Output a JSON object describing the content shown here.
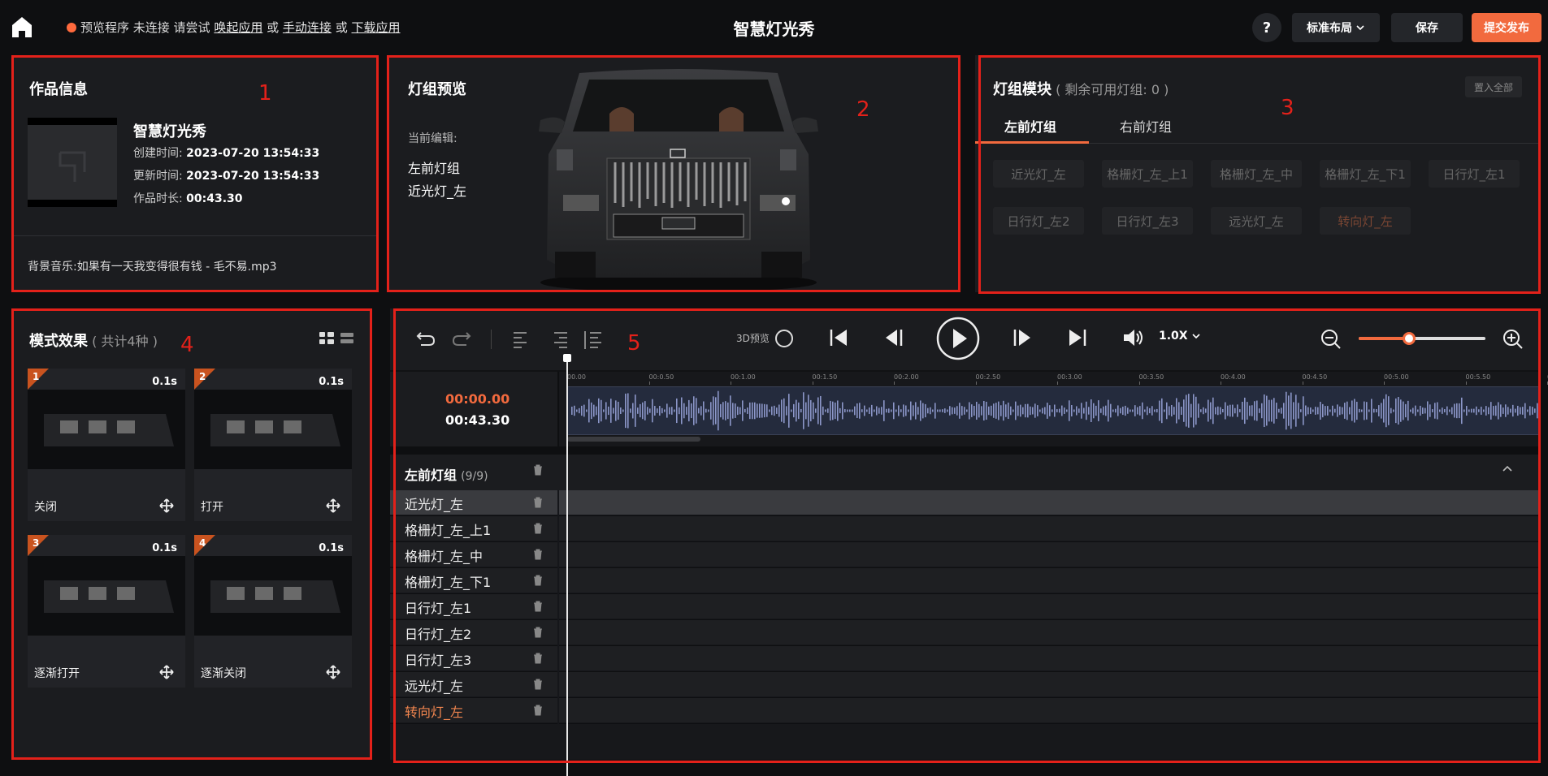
{
  "topbar": {
    "status_text": "预览程序 未连接 请尝试",
    "link_wake": "唤起应用",
    "or1": "或",
    "link_manual": "手动连接",
    "or2": "或",
    "link_download": "下载应用",
    "title": "智慧灯光秀",
    "help": "?",
    "layout_label": "标准布局",
    "save_label": "保存",
    "publish_label": "提交发布"
  },
  "works_info": {
    "panel_title": "作品信息",
    "annotation": "1",
    "name": "智慧灯光秀",
    "created_label": "创建时间:",
    "created": "2023-07-20 13:54:33",
    "updated_label": "更新时间:",
    "updated": "2023-07-20 13:54:33",
    "duration_label": "作品时长:",
    "duration": "00:43.30",
    "music_label": "背景音乐:",
    "music": "如果有一天我变得很有钱 - 毛不易.mp3"
  },
  "preview": {
    "panel_title": "灯组预览",
    "annotation": "2",
    "editing_label": "当前编辑:",
    "group": "左前灯组",
    "light": "近光灯_左"
  },
  "modules": {
    "panel_title": "灯组模块",
    "remaining": "( 剩余可用灯组: 0 )",
    "annotation": "3",
    "import_all": "置入全部",
    "tabs": [
      "左前灯组",
      "右前灯组"
    ],
    "chips": [
      "近光灯_左",
      "格栅灯_左_上1",
      "格栅灯_左_中",
      "格栅灯_左_下1",
      "日行灯_左1",
      "日行灯_左2",
      "日行灯_左3",
      "远光灯_左",
      "转向灯_左"
    ]
  },
  "effects": {
    "panel_title": "模式效果",
    "count": "( 共计4种 )",
    "annotation": "4",
    "items": [
      {
        "num": "1",
        "dur": "0.1s",
        "name": "关闭"
      },
      {
        "num": "2",
        "dur": "0.1s",
        "name": "打开"
      },
      {
        "num": "3",
        "dur": "0.1s",
        "name": "逐渐打开"
      },
      {
        "num": "4",
        "dur": "0.1s",
        "name": "逐渐关闭"
      }
    ]
  },
  "timeline": {
    "annotation": "5",
    "preview3d": "3D预览",
    "speed": "1.0X",
    "current_time": "00:00.00",
    "total_time": "00:43.30",
    "zoom_level": 0.4,
    "ruler": [
      "00.00",
      "00:0.50",
      "00:1.00",
      "00:1.50",
      "00:2.00",
      "00:2.50",
      "00:3.00",
      "00:3.50",
      "00:4.00",
      "00:4.50",
      "00:5.00",
      "00:5.50",
      "00"
    ],
    "group_title": "左前灯组",
    "group_count": "(9/9)",
    "tracks": [
      "近光灯_左",
      "格栅灯_左_上1",
      "格栅灯_左_中",
      "格栅灯_左_下1",
      "日行灯_左1",
      "日行灯_左2",
      "日行灯_左3",
      "远光灯_左",
      "转向灯_左"
    ]
  },
  "colors": {
    "accent": "#f26a3e",
    "annotation_red": "#e3211a",
    "panel_bg": "#1b1c1f",
    "waveform": "#8b96c8"
  }
}
